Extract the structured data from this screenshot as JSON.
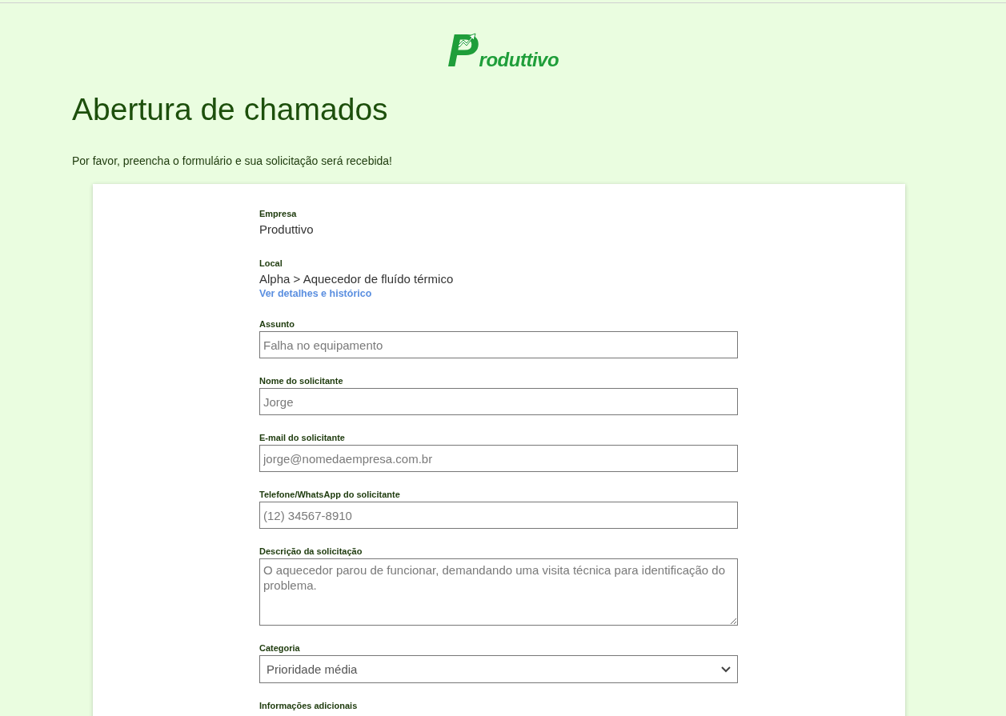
{
  "logo": {
    "text": "Produttivo"
  },
  "title": "Abertura de chamados",
  "subtitle": "Por favor, preencha o formulário e sua solicitação será recebida!",
  "info": [
    {
      "label": "Empresa",
      "value": "Produttivo"
    },
    {
      "label": "Local",
      "value": "Alpha > Aquecedor de fluído térmico",
      "link": "Ver detalhes e histórico"
    }
  ],
  "fields": [
    {
      "kind": "input",
      "label": "Assunto",
      "placeholder": "Falha no equipamento"
    },
    {
      "kind": "input",
      "label": "Nome do solicitante",
      "placeholder": "Jorge"
    },
    {
      "kind": "input",
      "label": "E-mail do solicitante",
      "placeholder": "jorge@nomedaempresa.com.br"
    },
    {
      "kind": "input",
      "label": "Telefone/WhatsApp do solicitante",
      "placeholder": "(12) 34567-8910"
    },
    {
      "kind": "textarea",
      "label": "Descrição da solicitação",
      "placeholder": "O aquecedor parou de funcionar, demandando uma visita técnica para identificação do problema."
    },
    {
      "kind": "select",
      "label": "Categoria",
      "value": "Prioridade média"
    },
    {
      "kind": "label",
      "label": "Informações adicionais"
    }
  ]
}
